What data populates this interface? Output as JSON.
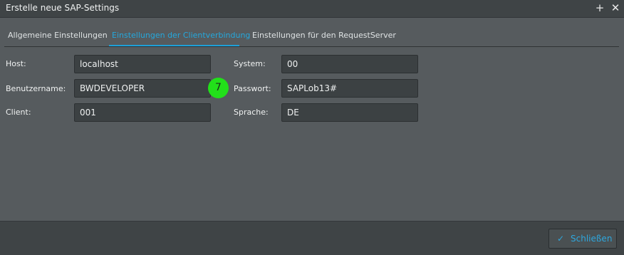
{
  "window": {
    "title": "Erstelle neue SAP-Settings",
    "add_icon": "plus-icon",
    "close_icon": "close-icon"
  },
  "tabs": [
    {
      "label": "Allgemeine Einstellungen",
      "active": false
    },
    {
      "label": "Einstellungen der Clientverbindung",
      "active": true
    },
    {
      "label": "Einstellungen für den RequestServer",
      "active": false
    }
  ],
  "form": {
    "host": {
      "label": "Host:",
      "value": "localhost"
    },
    "username": {
      "label": "Benutzername:",
      "value": "BWDEVELOPER"
    },
    "client": {
      "label": "Client:",
      "value": "001"
    },
    "system": {
      "label": "System:",
      "value": "00"
    },
    "password": {
      "label": "Passwort:",
      "value": "SAPLob13#"
    },
    "language": {
      "label": "Sprache:",
      "value": "DE"
    }
  },
  "badge": {
    "text": "7",
    "color": "#22e01a"
  },
  "footer": {
    "close_label": "Schließen",
    "close_icon": "check-icon"
  },
  "colors": {
    "accent": "#1ea0d8",
    "background": "#565b5e",
    "field": "#3c4143"
  }
}
